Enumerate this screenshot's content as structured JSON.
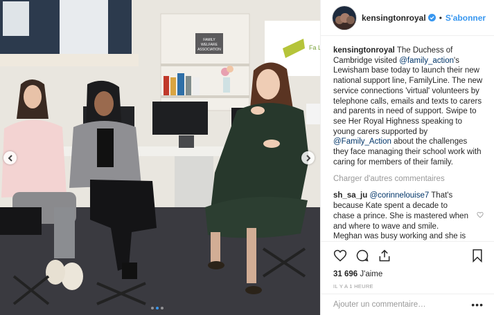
{
  "post": {
    "photo_alt": "The Duchess of Cambridge speaking with young carers",
    "sign_text": [
      "FAMILY",
      "WELFARE",
      "ASSOCIATION"
    ],
    "banner_text": "Fa Lin",
    "carousel": {
      "total": 3,
      "active_index": 1
    }
  },
  "header": {
    "username": "kensingtonroyal",
    "separator": "•",
    "follow_label": "S'abonner"
  },
  "caption": {
    "username": "kensingtonroyal",
    "part1": " The Duchess of Cambridge visited ",
    "mention1": "@family_action",
    "part2": "'s Lewisham base today to launch their new national support line, FamilyLine. The new service connections 'virtual' volunteers by telephone calls, emails and texts to carers and parents in need of support. Swipe to see Her Royal Highness speaking to young carers supported by ",
    "mention2": "@Family_Action",
    "part3": " about the challenges they face managing their school work with caring for members of their family."
  },
  "load_more_label": "Charger d'autres commentaires",
  "comments": [
    {
      "username": "sh_sa_ju",
      "mention": "@corinnelouise7",
      "text": " That's because Kate spent a decade to chase a prince. She is mastered when and where to wave and smile. Meghan was busy working and she is new to RF. She will learn in due course"
    }
  ],
  "likes": {
    "count": "31 696",
    "label": "J'aime"
  },
  "timestamp": "IL Y A 1 HEURE",
  "comment_input": {
    "placeholder": "Ajouter un commentaire…"
  },
  "more_label": "•••",
  "colors": {
    "accent": "#3897f0",
    "mention": "#003569",
    "muted": "#999999"
  }
}
